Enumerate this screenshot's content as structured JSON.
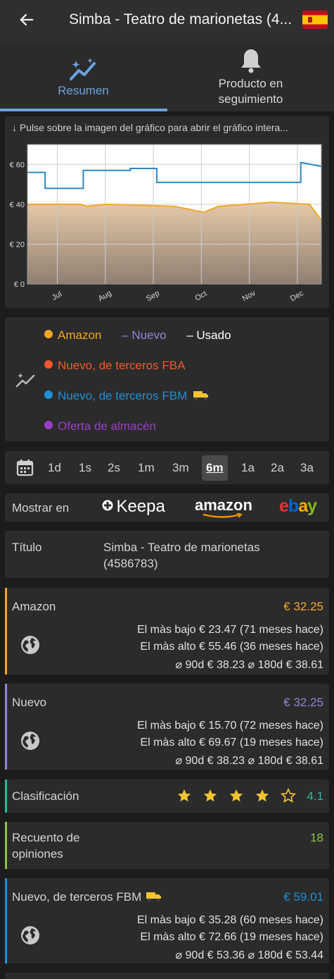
{
  "header": {
    "title": "Simba - Teatro de marionetas (4...",
    "back_icon": "arrow-left-icon",
    "flag_icon": "spain-flag-icon"
  },
  "tabs": [
    {
      "label_1": "Resumen",
      "label_2": "",
      "icon": "chart-sparkle-icon",
      "active": true
    },
    {
      "label_1": "Producto en",
      "label_2": "seguimiento",
      "icon": "bell-icon",
      "active": false
    }
  ],
  "chart_hint": "↓ Pulse sobre la imagen del gráfico para abrir el gráfico intera...",
  "chart_data": {
    "type": "line",
    "x_ticks": [
      "Jul",
      "Aug",
      "Sep",
      "Oct",
      "Nov",
      "Dec"
    ],
    "y_ticks": [
      "€ 60",
      "€ 40",
      "€ 20",
      "€ 0"
    ],
    "ylim": [
      0,
      70
    ],
    "grid": true,
    "series": [
      {
        "name": "Amazon",
        "color": "#f4a62a",
        "fill": true,
        "points": [
          [
            0,
            40
          ],
          [
            0.18,
            40
          ],
          [
            0.2,
            39
          ],
          [
            0.27,
            40
          ],
          [
            0.5,
            39
          ],
          [
            0.6,
            36
          ],
          [
            0.65,
            39
          ],
          [
            0.83,
            41
          ],
          [
            0.96,
            40
          ],
          [
            1,
            32
          ]
        ]
      },
      {
        "name": "Nuevo",
        "color": "#2d87c8",
        "fill": false,
        "points": [
          [
            0,
            56
          ],
          [
            0.06,
            56
          ],
          [
            0.06,
            48
          ],
          [
            0.19,
            48
          ],
          [
            0.19,
            57
          ],
          [
            0.35,
            57
          ],
          [
            0.35,
            58
          ],
          [
            0.44,
            58
          ],
          [
            0.44,
            51
          ],
          [
            0.58,
            51
          ],
          [
            0.62,
            51
          ],
          [
            0.84,
            51
          ],
          [
            0.93,
            51
          ],
          [
            0.93,
            61
          ],
          [
            1,
            59
          ]
        ]
      }
    ]
  },
  "legend": {
    "amazon": {
      "label": "Amazon",
      "color": "#f4a62a"
    },
    "nuevo": {
      "label": "Nuevo",
      "color": "#8f86d9",
      "marker": "–"
    },
    "usado": {
      "label": "Usado",
      "color": "#ffffff",
      "marker": "–"
    },
    "fba": {
      "label": "Nuevo, de terceros FBA",
      "color": "#f2592a"
    },
    "fbm": {
      "label": "Nuevo, de terceros FBM",
      "color": "#1e90d8"
    },
    "almacen": {
      "label": "Oferta de almacén",
      "color": "#9b3ec7"
    },
    "icon": "sparkle-chart-icon"
  },
  "ranges": [
    "1d",
    "1s",
    "2s",
    "1m",
    "3m",
    "6m",
    "1a",
    "2a",
    "3a"
  ],
  "selected_range": "6m",
  "show_in": {
    "label": "Mostrar en",
    "keepa": "Keepa",
    "amazon": "amazon",
    "ebay": "ebay"
  },
  "title_row": {
    "label": "Título",
    "value_1": "Simba - Teatro de marionetas",
    "value_2": "(4586783)"
  },
  "amazon_card": {
    "label": "Amazon",
    "price": "€ 32.25",
    "color": "#f4a62a",
    "low": "El màs bajo € 23.47 (71 meses hace)",
    "high": "El màs alto € 55.46 (36 meses hace)",
    "avg": "⌀ 90d € 38.23 ⌀ 180d € 38.61"
  },
  "nuevo_card": {
    "label": "Nuevo",
    "price": "€ 32.25",
    "color": "#8f86d9",
    "low": "El màs bajo € 15.70 (72 meses hace)",
    "high": "El màs alto € 69.67 (19 meses hace)",
    "avg": "⌀ 90d € 38.23 ⌀ 180d € 38.61"
  },
  "rating": {
    "label": "Clasificación",
    "value": "4.1",
    "stars": 4.1,
    "color": "#2cb8a0"
  },
  "reviews": {
    "label_1": "Recuento de",
    "label_2": "opiniones",
    "value": "18",
    "color": "#8bc34a"
  },
  "fbm_card": {
    "label": "Nuevo, de terceros FBM",
    "price": "€ 59.01",
    "color": "#1e90d8",
    "low": "El màs bajo € 35.28 (60 meses hace)",
    "high": "El màs alto € 72.66 (19 meses hace)",
    "avg": "⌀ 90d € 53.36 ⌀ 180d € 53.44"
  }
}
